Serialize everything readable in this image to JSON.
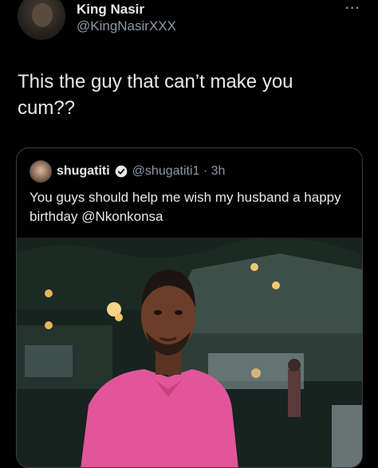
{
  "tweet": {
    "author": {
      "display_name": "King Nasir",
      "handle": "@KingNasirXXX"
    },
    "more_icon": "···",
    "text": "This the guy that can’t make you cum??"
  },
  "quoted_tweet": {
    "author": {
      "display_name": "shugatiti",
      "handle_time": "@shugatiti1 · 3h",
      "verified": true
    },
    "text": "You guys should help me wish my husband a happy birthday @Nkonkonsa"
  },
  "icons": {
    "more": "more-icon",
    "verified": "verified-badge-icon"
  },
  "colors": {
    "background": "#000000",
    "primary_text": "#e7e9ea",
    "secondary_text": "#8b98a5",
    "card_border": "#3a3f44",
    "shirt_pink": "#e2559b"
  }
}
